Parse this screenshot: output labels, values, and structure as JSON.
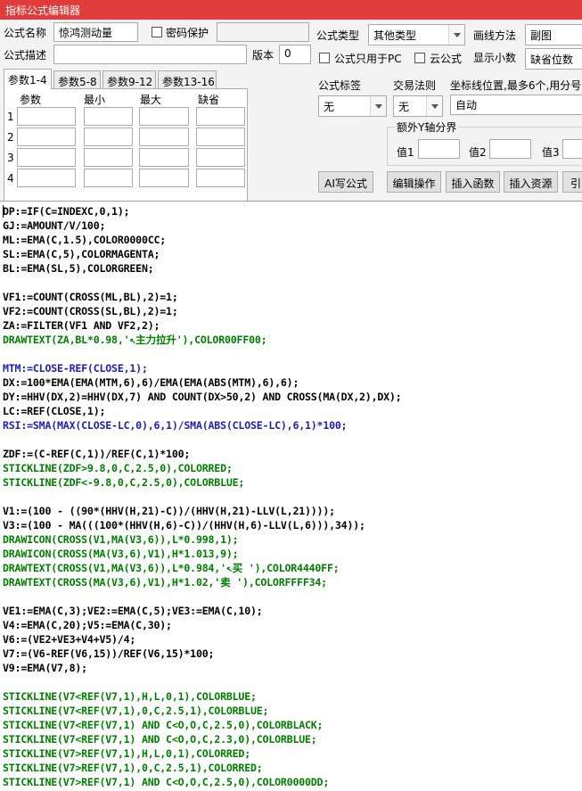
{
  "window": {
    "title": "指标公式编辑器"
  },
  "form": {
    "formula_name_label": "公式名称",
    "formula_name_value": "惊鸿测动量",
    "password_label": "密码保护",
    "formula_desc_label": "公式描述",
    "formula_desc_value": "",
    "version_label": "版本",
    "version_value": "0",
    "formula_type_label": "公式类型",
    "formula_type_value": "其他类型",
    "draw_method_label": "画线方法",
    "draw_method_value": "副图",
    "pc_only_label": "公式只用于PC",
    "cloud_label": "云公式",
    "decimals_label": "显示小数",
    "decimals_value": "缺省位数",
    "tag_label": "公式标签",
    "tag_value": "无",
    "trade_rule_label": "交易法则",
    "trade_rule_value": "无",
    "axis_label": "坐标线位置,最多6个,用分号分",
    "axis_value": "自动",
    "extra_axis_legend": "额外Y轴分界",
    "value1_label": "值1",
    "value2_label": "值2",
    "value3_label": "值3"
  },
  "tabs": [
    "参数1-4",
    "参数5-8",
    "参数9-12",
    "参数13-16"
  ],
  "param_table": {
    "headers": [
      "参数",
      "最小",
      "最大",
      "缺省"
    ],
    "rows": [
      "1",
      "2",
      "3",
      "4"
    ]
  },
  "buttons": {
    "ai": "AI写公式",
    "edit": "编辑操作",
    "insert_func": "插入函数",
    "insert_res": "插入资源",
    "more": "引"
  },
  "code_lines": [
    {
      "text": "DP:=IF(C=INDEXC,0,1);",
      "color": "black"
    },
    {
      "text": "GJ:=AMOUNT/V/100;",
      "color": "black"
    },
    {
      "text": "ML:=EMA(C,1.5),COLOR0000CC;",
      "color": "black"
    },
    {
      "text": "SL:=EMA(C,5),COLORMAGENTA;",
      "color": "black"
    },
    {
      "text": "BL:=EMA(SL,5),COLORGREEN;",
      "color": "black"
    },
    {
      "text": "",
      "color": "black"
    },
    {
      "text": "VF1:=COUNT(CROSS(ML,BL),2)=1;",
      "color": "black"
    },
    {
      "text": "VF2:=COUNT(CROSS(SL,BL),2)=1;",
      "color": "black"
    },
    {
      "text": "ZA:=FILTER(VF1 AND VF2,2);",
      "color": "black"
    },
    {
      "text": "DRAWTEXT(ZA,BL*0.98,'↖主力拉升'),COLOR00FF00;",
      "color": "green"
    },
    {
      "text": "",
      "color": "black"
    },
    {
      "text": "MTM:=CLOSE-REF(CLOSE,1);",
      "color": "blue"
    },
    {
      "text": "DX:=100*EMA(EMA(MTM,6),6)/EMA(EMA(ABS(MTM),6),6);",
      "color": "black"
    },
    {
      "text": "DY:=HHV(DX,2)=HHV(DX,7) AND COUNT(DX>50,2) AND CROSS(MA(DX,2),DX);",
      "color": "black"
    },
    {
      "text": "LC:=REF(CLOSE,1);",
      "color": "black"
    },
    {
      "text": "RSI:=SMA(MAX(CLOSE-LC,0),6,1)/SMA(ABS(CLOSE-LC),6,1)*100;",
      "color": "blue"
    },
    {
      "text": "",
      "color": "black"
    },
    {
      "text": "ZDF:=(C-REF(C,1))/REF(C,1)*100;",
      "color": "black"
    },
    {
      "text": "STICKLINE(ZDF>9.8,0,C,2.5,0),COLORRED;",
      "color": "green"
    },
    {
      "text": "STICKLINE(ZDF<-9.8,0,C,2.5,0),COLORBLUE;",
      "color": "green"
    },
    {
      "text": "",
      "color": "black"
    },
    {
      "text": "V1:=(100 - ((90*(HHV(H,21)-C))/(HHV(H,21)-LLV(L,21))));",
      "color": "black"
    },
    {
      "text": "V3:=(100 - MA(((100*(HHV(H,6)-C))/(HHV(H,6)-LLV(L,6))),34));",
      "color": "black"
    },
    {
      "text": "DRAWICON(CROSS(V1,MA(V3,6)),L*0.998,1);",
      "color": "green"
    },
    {
      "text": "DRAWICON(CROSS(MA(V3,6),V1),H*1.013,9);",
      "color": "green"
    },
    {
      "text": "DRAWTEXT(CROSS(V1,MA(V3,6)),L*0.984,'↖买 '),COLOR4440FF;",
      "color": "green"
    },
    {
      "text": "DRAWTEXT(CROSS(MA(V3,6),V1),H*1.02,'卖 '),COLORFFFF34;",
      "color": "green"
    },
    {
      "text": "",
      "color": "black"
    },
    {
      "text": "VE1:=EMA(C,3);VE2:=EMA(C,5);VE3:=EMA(C,10);",
      "color": "black"
    },
    {
      "text": "V4:=EMA(C,20);V5:=EMA(C,30);",
      "color": "black"
    },
    {
      "text": "V6:=(VE2+VE3+V4+V5)/4;",
      "color": "black"
    },
    {
      "text": "V7:=(V6-REF(V6,15))/REF(V6,15)*100;",
      "color": "black"
    },
    {
      "text": "V9:=EMA(V7,8);",
      "color": "black"
    },
    {
      "text": "",
      "color": "black"
    },
    {
      "text": "STICKLINE(V7<REF(V7,1),H,L,0,1),COLORBLUE;",
      "color": "green"
    },
    {
      "text": "STICKLINE(V7<REF(V7,1),0,C,2.5,1),COLORBLUE;",
      "color": "green"
    },
    {
      "text": "STICKLINE(V7<REF(V7,1) AND C<O,O,C,2.5,0),COLORBLACK;",
      "color": "green"
    },
    {
      "text": "STICKLINE(V7<REF(V7,1) AND C<O,O,C,2.3,0),COLORBLUE;",
      "color": "green"
    },
    {
      "text": "STICKLINE(V7>REF(V7,1),H,L,0,1),COLORRED;",
      "color": "green"
    },
    {
      "text": "STICKLINE(V7>REF(V7,1),0,C,2.5,1),COLORRED;",
      "color": "green"
    },
    {
      "text": "STICKLINE(V7>REF(V7,1) AND C<O,O,C,2.5,0),COLOR0000DD;",
      "color": "green"
    }
  ]
}
